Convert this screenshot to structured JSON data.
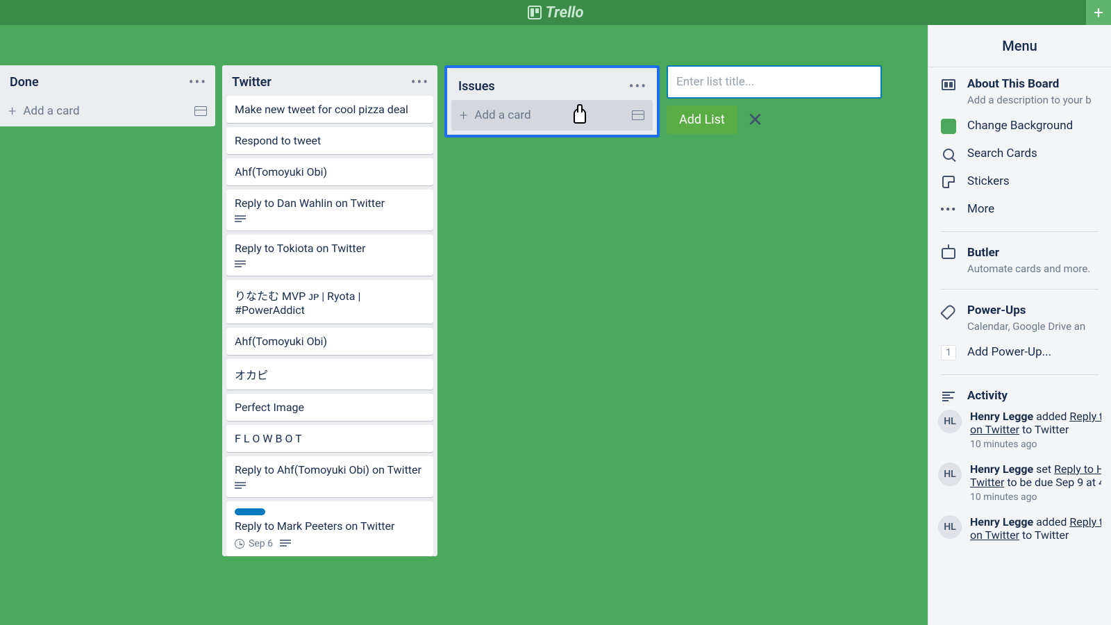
{
  "app": {
    "name": "Trello"
  },
  "butler_button": "Butler",
  "lists": [
    {
      "title": "Done",
      "cards": [],
      "add_card_label": "Add a card"
    },
    {
      "title": "Twitter",
      "cards": [
        {
          "text": "Make new tweet for cool pizza deal"
        },
        {
          "text": "Respond to tweet"
        },
        {
          "text": "Ahf(Tomoyuki Obi)"
        },
        {
          "text": "Reply to Dan Wahlin on Twitter",
          "has_desc": true
        },
        {
          "text": "Reply to Tokiota on Twitter",
          "has_desc": true
        },
        {
          "text": "りなたむ MVP ᴊᴘ | Ryota | #PowerAddict"
        },
        {
          "text": "Ahf(Tomoyuki Obi)"
        },
        {
          "text": "オカピ"
        },
        {
          "text": "Perfect Image"
        },
        {
          "text": "F L O W B O T"
        },
        {
          "text": "Reply to Ahf(Tomoyuki Obi) on Twitter",
          "has_desc": true
        },
        {
          "text": "Reply to Mark Peeters on Twitter",
          "label": "blue",
          "due": "Sep 6",
          "has_desc": true
        }
      ],
      "add_card_label": "Add a card"
    },
    {
      "title": "Issues",
      "cards": [],
      "add_card_label": "Add a card",
      "highlighted": true
    }
  ],
  "new_list": {
    "placeholder": "Enter list title...",
    "add_button": "Add List"
  },
  "menu": {
    "title": "Menu",
    "about_title": "About This Board",
    "about_sub": "Add a description to your b",
    "change_bg": "Change Background",
    "search_cards": "Search Cards",
    "stickers": "Stickers",
    "more": "More",
    "butler_title": "Butler",
    "butler_sub": "Automate cards and more.",
    "powerups_title": "Power-Ups",
    "powerups_sub": "Calendar, Google Drive an",
    "powerups_count": "1",
    "add_powerup": "Add Power-Up...",
    "activity_title": "Activity"
  },
  "activity": [
    {
      "initials": "HL",
      "user": "Henry Legge",
      "verb": "added",
      "link": "Reply t",
      "tail": "on Twitter",
      "extra": " to Twitter",
      "time": "10 minutes ago"
    },
    {
      "initials": "HL",
      "user": "Henry Legge",
      "verb": "set",
      "link": "Reply to H",
      "tail": "Twitter",
      "extra": " to be due Sep 9 at 4",
      "time": "10 minutes ago"
    },
    {
      "initials": "HL",
      "user": "Henry Legge",
      "verb": "added",
      "link": "Reply t",
      "tail": "on Twitter",
      "extra": " to Twitter",
      "time": ""
    }
  ]
}
